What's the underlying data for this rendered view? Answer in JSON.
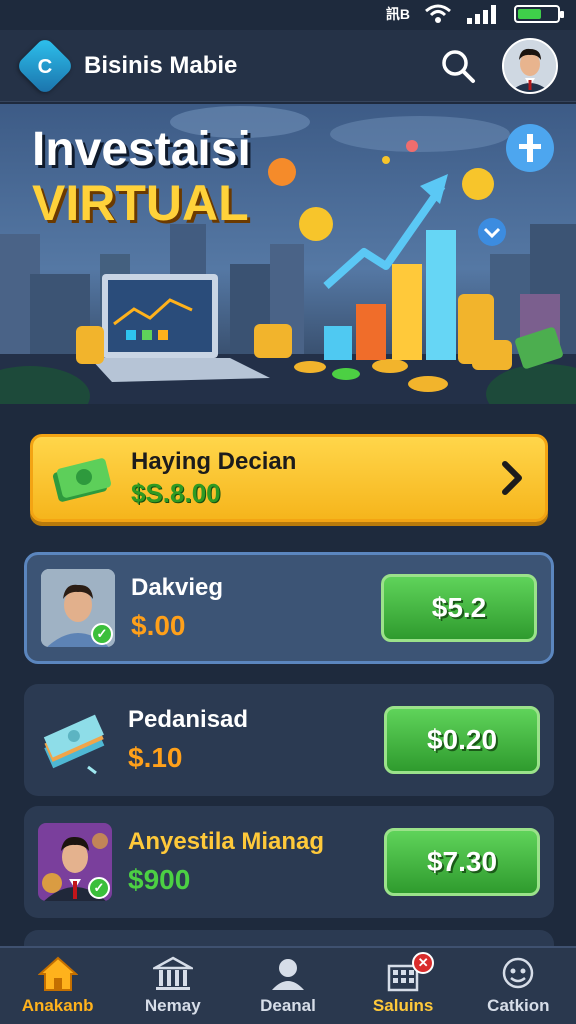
{
  "status_bar": {
    "network_label": "訊B",
    "battery_level": 0.6
  },
  "header": {
    "app_title": "Bisinis Mabie",
    "logo_glyph": "C"
  },
  "banner": {
    "title_line1": "Investaisi",
    "title_line2": "VIRTUAL"
  },
  "action_card": {
    "title": "Haying Decian",
    "amount": "$S.8.00"
  },
  "investments": [
    {
      "name": "Dakvieg",
      "value": "$.00",
      "price": "$5.2",
      "value_color": "orange",
      "selected": true
    },
    {
      "name": "Pedanisad",
      "value": "$.10",
      "price": "$0.20",
      "value_color": "orange",
      "selected": false
    },
    {
      "name": "Anyestila Mianag",
      "value": "$900",
      "price": "$7.30",
      "value_color": "green",
      "selected": false
    }
  ],
  "bottom_nav": [
    {
      "label": "Anakanb",
      "icon": "home-icon"
    },
    {
      "label": "Nemay",
      "icon": "bank-icon"
    },
    {
      "label": "Deanal",
      "icon": "person-icon"
    },
    {
      "label": "Saluins",
      "icon": "building-icon"
    },
    {
      "label": "Catkion",
      "icon": "support-icon"
    }
  ],
  "colors": {
    "accent": "#ffb21c",
    "price_green": "#2f9b2e",
    "background": "#1e2a3d"
  }
}
